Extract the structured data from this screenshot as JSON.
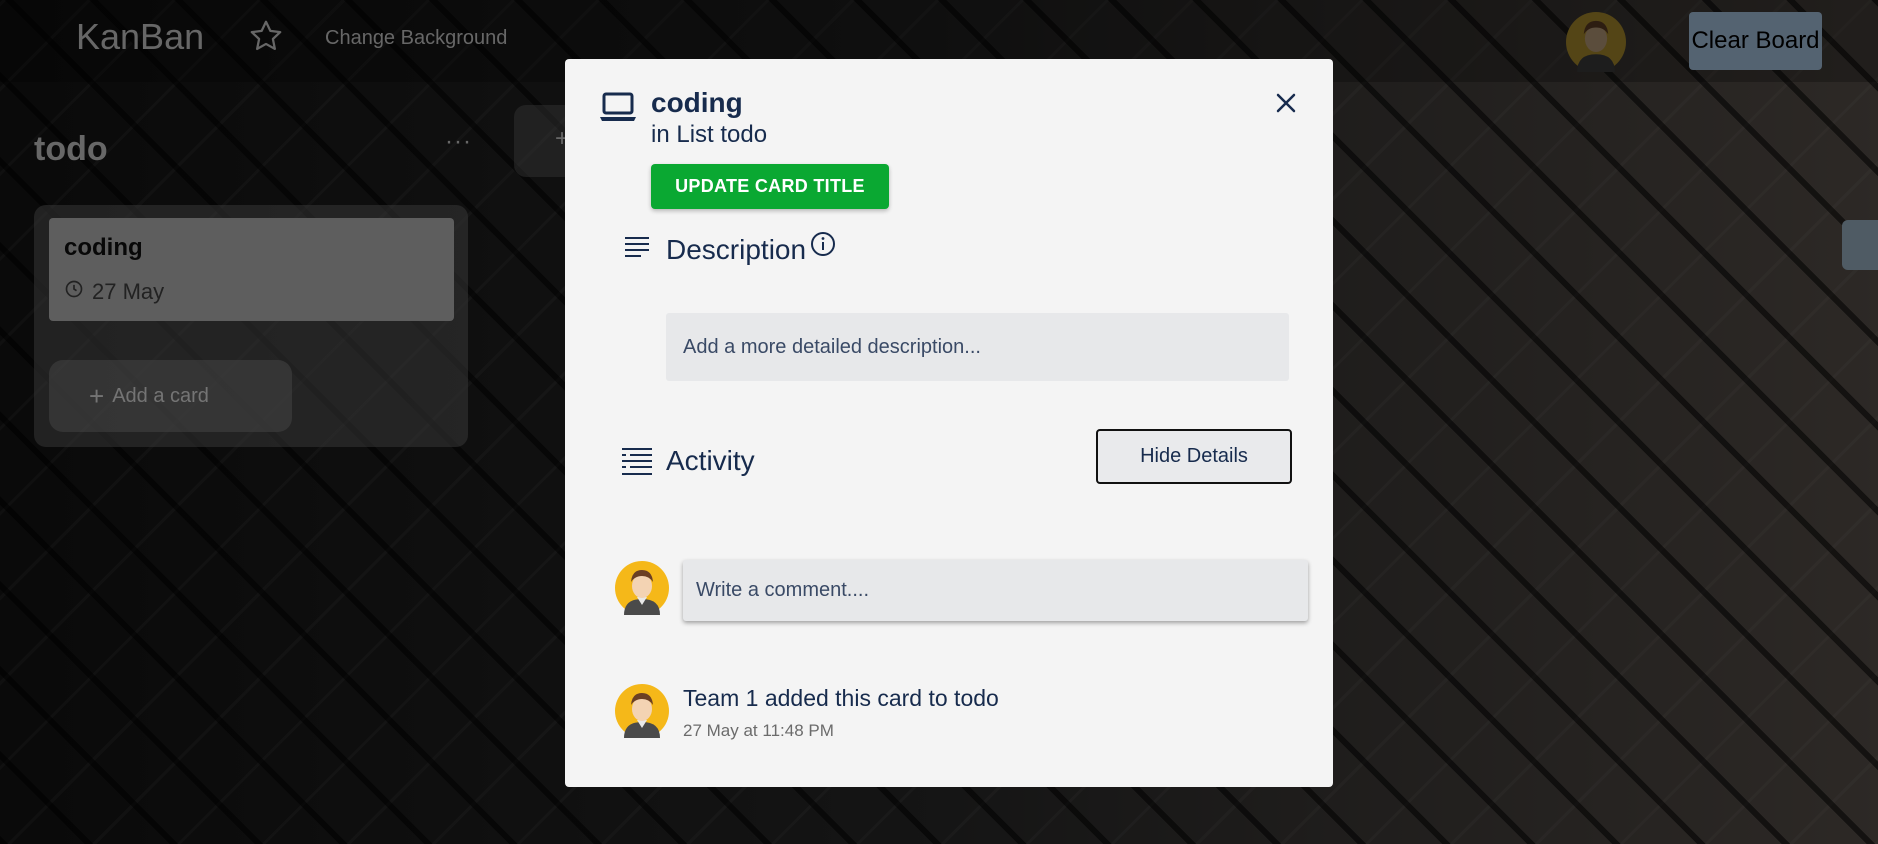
{
  "board": {
    "brand": "KanBan",
    "change_background": "Change Background",
    "clear_board": "Clear Board",
    "list": {
      "title": "todo",
      "menu": "···",
      "card": {
        "title": "coding",
        "date": "27 May"
      },
      "add_card": "Add a card",
      "add_card_plus": "+"
    },
    "add_list_plus": "+"
  },
  "modal": {
    "card_title": "coding",
    "in_list": "in List todo",
    "update_button": "UPDATE CARD TITLE",
    "description_label": "Description",
    "description_placeholder": "Add a more detailed description...",
    "activity_label": "Activity",
    "hide_details": "Hide Details",
    "comment_placeholder": "Write a comment....",
    "activity_entry": "Team 1 added this card to todo",
    "activity_time": "27 May at 11:48 PM"
  },
  "colors": {
    "update_button": "#0aa832",
    "modal_bg": "#f4f4f4",
    "text": "#172b4d",
    "avatar_bg": "#f5b819"
  },
  "icons": [
    "star-icon",
    "laptop-icon",
    "description-icon",
    "info-icon",
    "activity-icon",
    "close-icon",
    "clock-icon",
    "plus-icon",
    "avatar"
  ]
}
